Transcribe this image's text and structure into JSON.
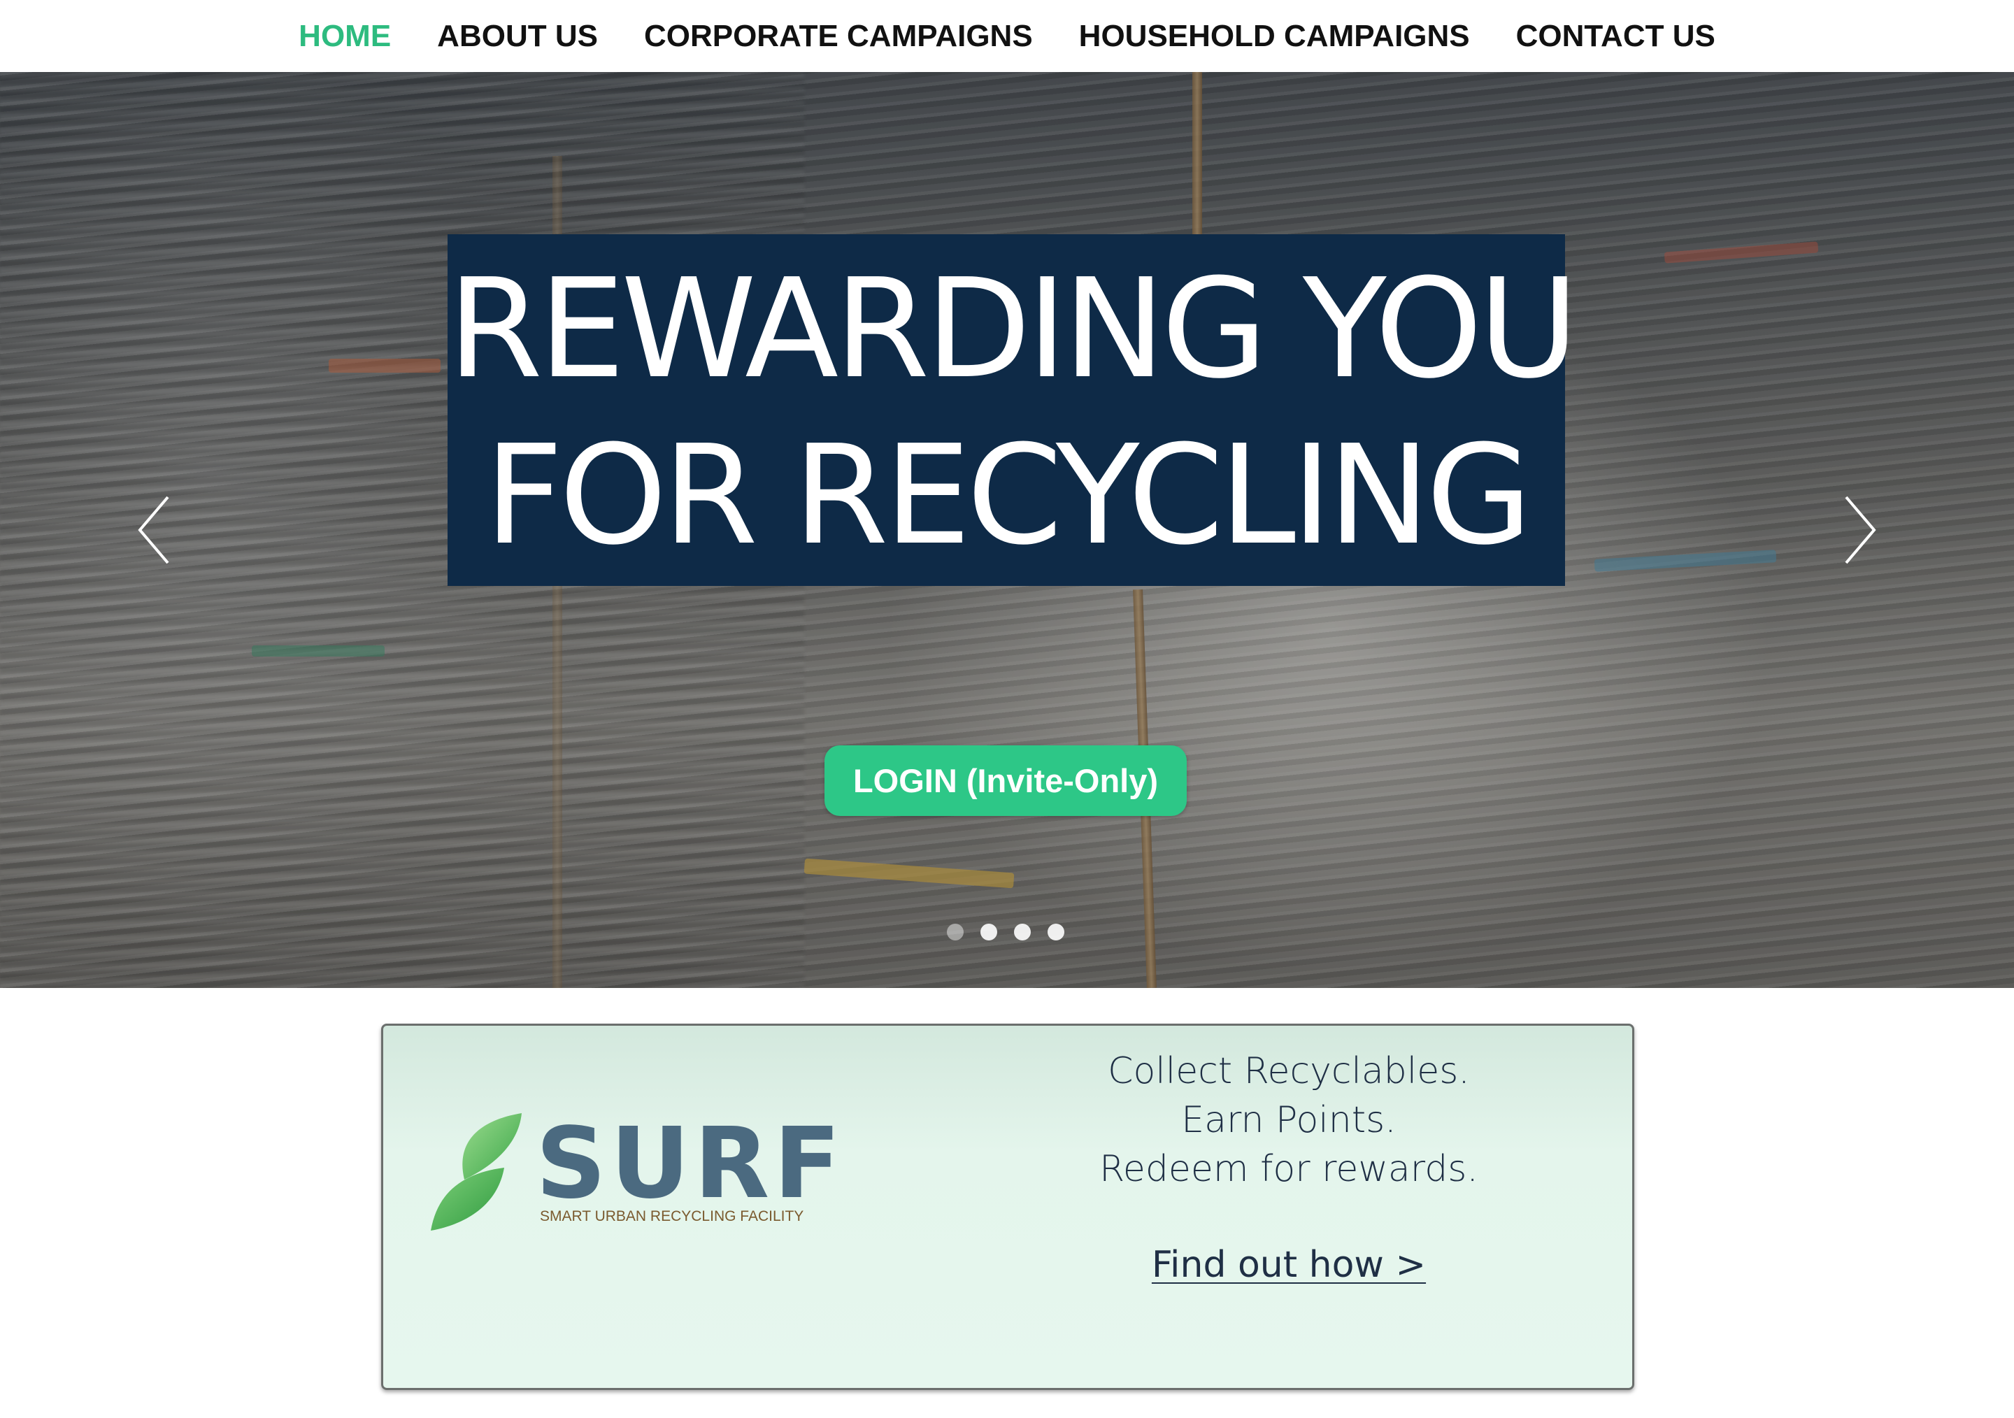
{
  "nav": {
    "items": [
      {
        "label": "HOME",
        "active": true
      },
      {
        "label": "ABOUT US",
        "active": false
      },
      {
        "label": "CORPORATE CAMPAIGNS",
        "active": false
      },
      {
        "label": "HOUSEHOLD CAMPAIGNS",
        "active": false
      },
      {
        "label": "CONTACT US",
        "active": false
      }
    ]
  },
  "hero": {
    "headline_line1": "REWARDING YOU",
    "headline_line2": "FOR RECYCLING",
    "login_label": "LOGIN (Invite-Only)",
    "prev_icon": "chevron-left-icon",
    "next_icon": "chevron-right-icon",
    "slides_total": 4,
    "active_slide": 1
  },
  "card": {
    "logo_word": "SURF",
    "logo_tagline": "SMART URBAN RECYCLING FACILITY",
    "line1": "Collect Recyclables.",
    "line2": "Earn Points.",
    "line3": "Redeem for rewards.",
    "link_label": "Find out how >"
  },
  "colors": {
    "accent_green": "#2dbb7f",
    "headline_bg": "#0e2a47",
    "button_green": "#2dc787",
    "logo_blue": "#4b6a80",
    "card_bg": "#e4f5ec"
  }
}
